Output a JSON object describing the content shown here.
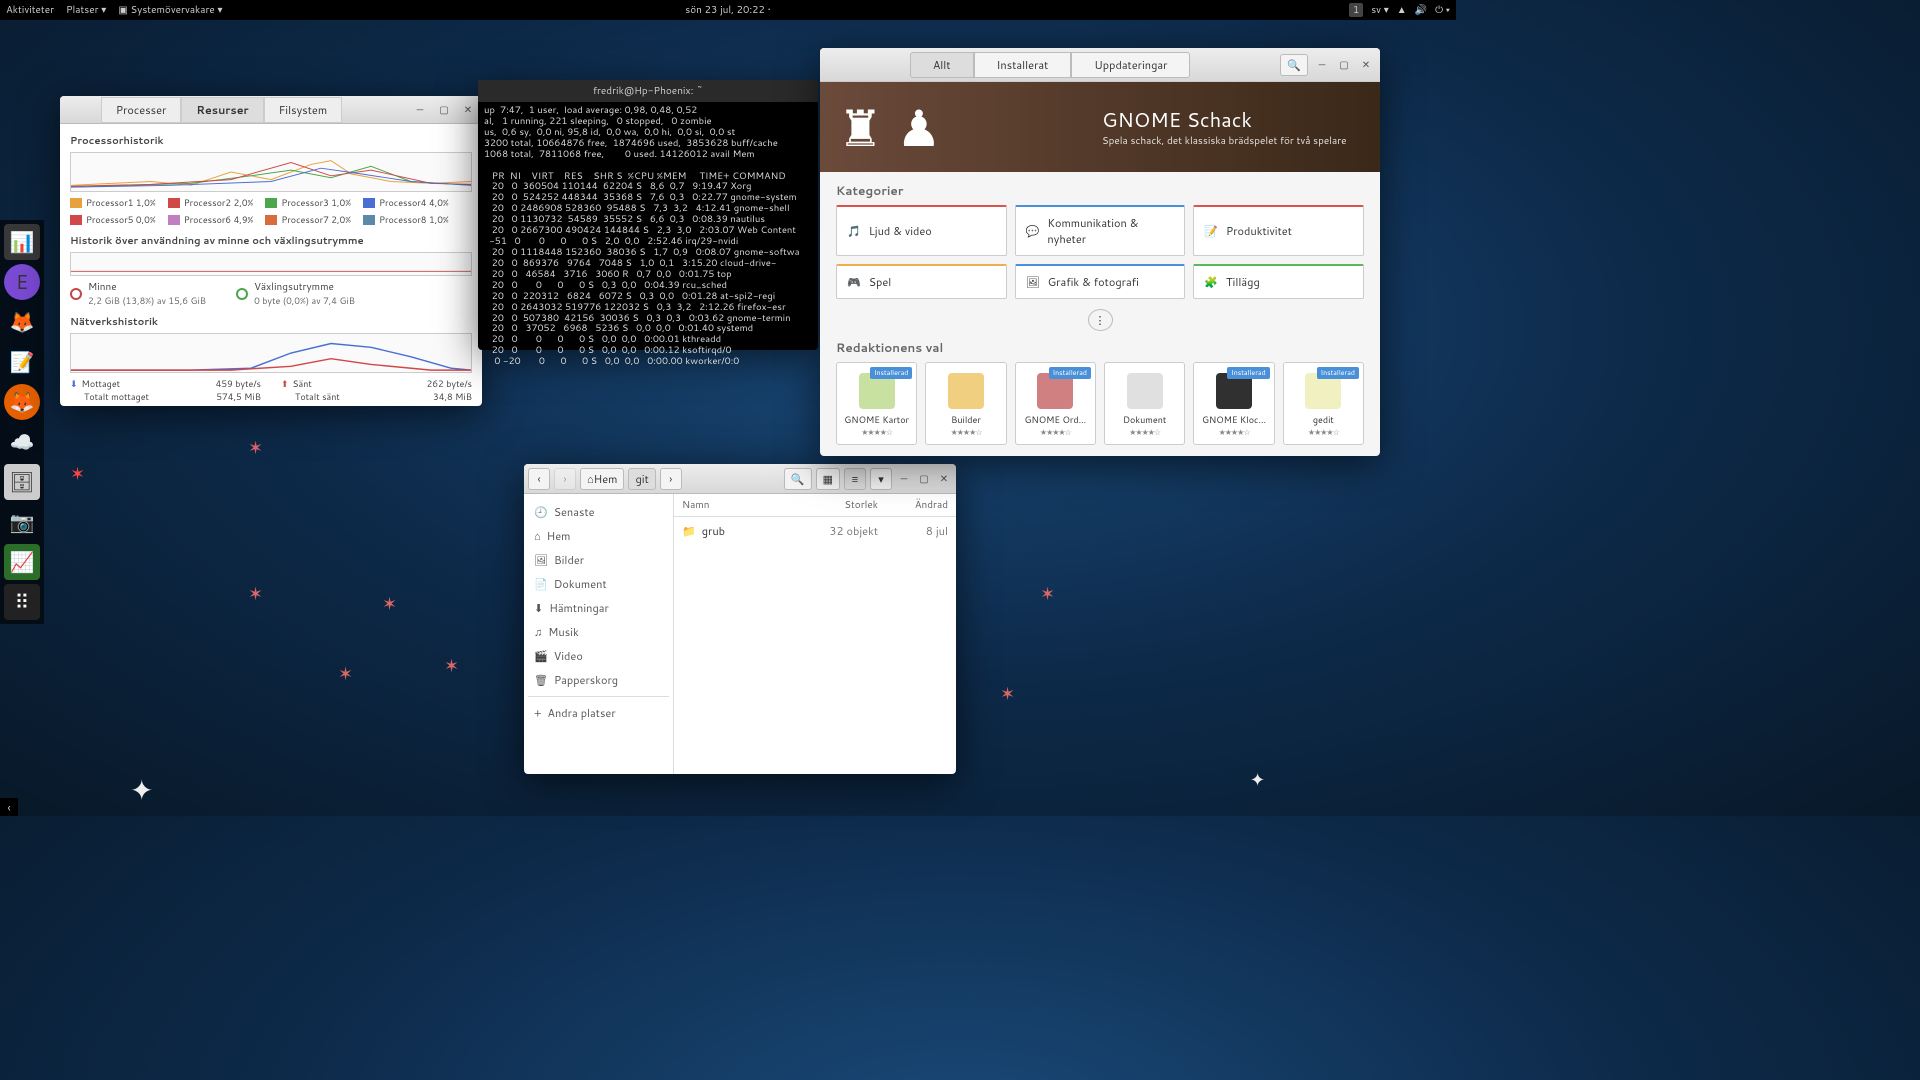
{
  "topbar": {
    "activities": "Aktiviteter",
    "places": "Platser",
    "app_menu": "Systemövervakare",
    "clock": "sön 23 jul, 20:22",
    "workspace": "1",
    "lang": "sv"
  },
  "sysmon": {
    "tabs": [
      "Processer",
      "Resurser",
      "Filsystem"
    ],
    "active_tab": 1,
    "cpu_title": "Processorhistorik",
    "cpu_legend": [
      {
        "name": "Processor1",
        "val": "1,0%",
        "color": "#e8a23c"
      },
      {
        "name": "Processor2",
        "val": "2,0%",
        "color": "#d04848"
      },
      {
        "name": "Processor3",
        "val": "1,0%",
        "color": "#4ca64c"
      },
      {
        "name": "Processor4",
        "val": "4,0%",
        "color": "#4a6fd4"
      },
      {
        "name": "Processor5",
        "val": "0,0%",
        "color": "#d04848"
      },
      {
        "name": "Processor6",
        "val": "4,9%",
        "color": "#c080c0"
      },
      {
        "name": "Processor7",
        "val": "2,0%",
        "color": "#d86c3c"
      },
      {
        "name": "Processor8",
        "val": "1,0%",
        "color": "#5a8aa8"
      }
    ],
    "mem_title": "Historik över användning av minne och växlingsutrymme",
    "mem_label": "Minne",
    "mem_value": "2,2 GiB (13,8%) av 15,6 GiB",
    "swap_label": "Växlingsutrymme",
    "swap_value": "0 byte (0,0%) av 7,4 GiB",
    "net_title": "Nätverkshistorik",
    "net_recv_label": "Mottaget",
    "net_recv_rate": "459 byte/s",
    "net_recv_total_label": "Totalt mottaget",
    "net_recv_total": "574,5 MiB",
    "net_sent_label": "Sänt",
    "net_sent_rate": "262 byte/s",
    "net_sent_total_label": "Totalt sänt",
    "net_sent_total": "34,8 MiB"
  },
  "terminal": {
    "title": "fredrik@Hp-Phoenix: ~",
    "text": "up  7:47,  1 user,  load average: 0,98, 0,48, 0,52\nal,   1 running, 221 sleeping,   0 stopped,   0 zombie\nus,  0,6 sy,  0,0 ni, 95,8 id,  0,0 wa,  0,0 hi,  0,0 si,  0,0 st\n3200 total, 10664876 free,  1874696 used,  3853628 buff/cache\n1068 total,  7811068 free,        0 used. 14126012 avail Mem\n\n   PR  NI    VIRT    RES    SHR S  %CPU %MEM     TIME+ COMMAND\n   20   0  360504 110144  62204 S   8,6  0,7   9:19.47 Xorg\n   20   0  524252 448344  35368 S   7,6  0,3   0:22.77 gnome-system\n   20   0 2486908 528360  95488 S   7,3  3,2   4:12.41 gnome-shell\n   20   0 1130732  54589  35552 S   6,6  0,3   0:08.39 nautilus\n   20   0 2667300 490424 144844 S   2,3  3,0   2:03.07 Web Content\n  -51   0       0      0      0 S   2,0  0,0   2:52.46 irq/29-nvidi\n   20   0 1118448 152360  38036 S   1,7  0,9   0:08.07 gnome-softwa\n   20   0  869376   9764   7048 S   1,0  0,1   3:15.20 cloud-drive-\n   20   0   46584   3716   3060 R   0,7  0,0   0:01.75 top\n   20   0       0      0      0 S   0,3  0,0   0:04.39 rcu_sched\n   20   0  220312   6824   6072 S   0,3  0,0   0:01.28 at-spi2-regi\n   20   0 2643032 519776 122032 S   0,3  3,2   2:12.26 firefox-esr\n   20   0  507380  42156  30036 S   0,3  0,3   0:03.62 gnome-termin\n   20   0   37052   6968   5236 S   0,0  0,0   0:01.40 systemd\n   20   0       0      0      0 S   0,0  0,0   0:00.01 kthreadd\n   20   0       0      0      0 S   0,0  0,0   0:00.12 ksoftirqd/0\n    0 -20       0      0      0 S   0,0  0,0   0:00.00 kworker/0:0"
  },
  "files": {
    "path_home": "Hem",
    "path_current": "git",
    "cols": [
      "Namn",
      "Storlek",
      "Ändrad"
    ],
    "sidebar": [
      "Senaste",
      "Hem",
      "Bilder",
      "Dokument",
      "Hämtningar",
      "Musik",
      "Video",
      "Papperskorg",
      "Andra platser"
    ],
    "rows": [
      {
        "name": "grub",
        "size": "32 objekt",
        "date": "8 jul"
      }
    ]
  },
  "software": {
    "tabs": [
      "Allt",
      "Installerat",
      "Uppdateringar"
    ],
    "hero_title": "GNOME Schack",
    "hero_sub": "Spela schack, det klassiska brädspelet för två spelare",
    "cat_title": "Kategorier",
    "cats": [
      {
        "label": "Ljud & video",
        "color": "#d9534f"
      },
      {
        "label": "Kommunikation & nyheter",
        "color": "#4a90d9"
      },
      {
        "label": "Produktivitet",
        "color": "#d9534f"
      },
      {
        "label": "Spel",
        "color": "#f0ad4e"
      },
      {
        "label": "Grafik & fotografi",
        "color": "#4a90d9"
      },
      {
        "label": "Tillägg",
        "color": "#5cb85c"
      }
    ],
    "picks_title": "Redaktionens val",
    "apps": [
      {
        "name": "GNOME Kartor",
        "installed": true,
        "icon": "#c8e0a0"
      },
      {
        "name": "Builder",
        "installed": false,
        "icon": "#f0d080"
      },
      {
        "name": "GNOME Ord…",
        "installed": true,
        "icon": "#d08080"
      },
      {
        "name": "Dokument",
        "installed": false,
        "icon": "#e0e0e0"
      },
      {
        "name": "GNOME Kloc…",
        "installed": true,
        "icon": "#303030"
      },
      {
        "name": "gedit",
        "installed": true,
        "icon": "#f0f0c0"
      }
    ],
    "installed_label": "Installerad"
  }
}
